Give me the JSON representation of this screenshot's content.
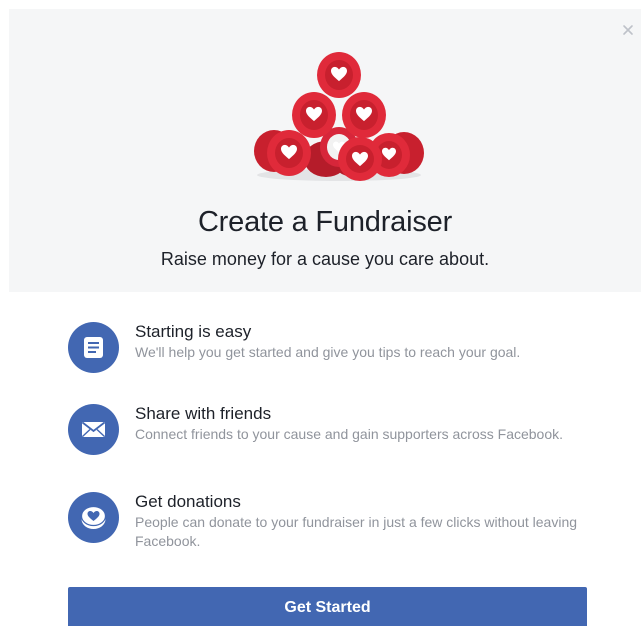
{
  "dialog": {
    "close_icon": "close-icon",
    "hero_icon": "hearts-pyramid-icon",
    "title": "Create a Fundraiser",
    "subtitle": "Raise money for a cause you care about."
  },
  "features": [
    {
      "icon": "document-icon",
      "title": "Starting is easy",
      "description": "We'll help you get started and give you tips to reach your goal."
    },
    {
      "icon": "envelope-icon",
      "title": "Share with friends",
      "description": "Connect friends to your cause and gain supporters across Facebook."
    },
    {
      "icon": "heart-coin-icon",
      "title": "Get donations",
      "description": "People can donate to your fundraiser in just a few clicks without leaving Facebook."
    }
  ],
  "cta": {
    "label": "Get Started"
  },
  "colors": {
    "brand_blue": "#4267b2",
    "heart_red": "#e02a3a",
    "hero_background": "#f5f6f7",
    "text_primary": "#1d2129",
    "text_secondary": "#90949c"
  }
}
